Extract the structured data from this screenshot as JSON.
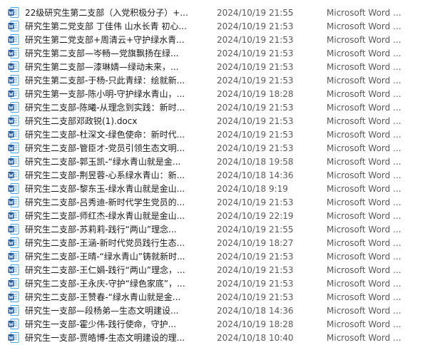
{
  "files": [
    {
      "name": "22级研究生第二支部（入党积极分子）+...",
      "date": "2024/10/19 21:55",
      "type": "Microsoft Word ...",
      "icon": "word-document-icon"
    },
    {
      "name": "研究生第二党支部 丁佳伟 山水长青 初心...",
      "date": "2024/10/19 21:53",
      "type": "Microsoft Word ...",
      "icon": "word-document-icon"
    },
    {
      "name": "研究生第二党支部+周清云+守护绿水青...",
      "date": "2024/10/19 21:53",
      "type": "Microsoft Word ...",
      "icon": "word-document-icon"
    },
    {
      "name": "研究生第二支部—岑畅—党旗飘扬在绿...",
      "date": "2024/10/19 21:53",
      "type": "Microsoft Word ...",
      "icon": "word-document-icon"
    },
    {
      "name": "研究生第二支部—漆琳婧—绿动未来，...",
      "date": "2024/10/19 21:53",
      "type": "Microsoft Word ...",
      "icon": "word-document-icon"
    },
    {
      "name": "研究生第二支部-于杨-只此青绿：绘就新...",
      "date": "2024/10/19 21:53",
      "type": "Microsoft Word ...",
      "icon": "word-document-icon"
    },
    {
      "name": "研究生第一支部-陈小明-守护绿水青山，...",
      "date": "2024/10/19 18:28",
      "type": "Microsoft Word ...",
      "icon": "word-document-icon"
    },
    {
      "name": "研究生二支部-陈曦-从理念到实践：新时...",
      "date": "2024/10/19 21:53",
      "type": "Microsoft Word ...",
      "icon": "word-document-icon"
    },
    {
      "name": "研究生二支部邓政锐(1).docx",
      "date": "2024/10/19 21:53",
      "type": "Microsoft Word ...",
      "icon": "word-document-icon"
    },
    {
      "name": "研究生二支部-杜深文-绿色使命：新时代...",
      "date": "2024/10/19 21:53",
      "type": "Microsoft Word ...",
      "icon": "word-document-icon"
    },
    {
      "name": "研究生二支部-管臣才-党员引领生态文明...",
      "date": "2024/10/19 21:53",
      "type": "Microsoft Word ...",
      "icon": "word-document-icon"
    },
    {
      "name": "研究生二支部-郭玉凯-“绿水青山就是金...",
      "date": "2024/10/18 19:58",
      "type": "Microsoft Word ...",
      "icon": "word-document-icon"
    },
    {
      "name": "研究生二支部-荆昱蓉-心系绿水青山：新...",
      "date": "2024/10/18 14:36",
      "type": "Microsoft Word ...",
      "icon": "word-document-icon"
    },
    {
      "name": "研究生二支部-黎东玉-绿水青山就是金山...",
      "date": "2024/10/18 9:19",
      "type": "Microsoft Word ...",
      "icon": "word-document-icon"
    },
    {
      "name": "研究生二支部-吕秀迪-新时代学生党员的...",
      "date": "2024/10/19 21:53",
      "type": "Microsoft Word ...",
      "icon": "word-document-icon"
    },
    {
      "name": "研究生二支部-师红杰-绿水青山就是金山...",
      "date": "2024/10/19 22:19",
      "type": "Microsoft Word ...",
      "icon": "word-document-icon"
    },
    {
      "name": "研究生二支部-苏莉莉-践行“两山”理念...",
      "date": "2024/10/19 21:55",
      "type": "Microsoft Word ...",
      "icon": "word-document-icon"
    },
    {
      "name": "研究生二支部-王涵-新时代党员践行生态...",
      "date": "2024/10/19 18:27",
      "type": "Microsoft Word ...",
      "icon": "word-document-icon"
    },
    {
      "name": "研究生二支部-王晴-“绿水青山”铸就新时...",
      "date": "2024/10/19 21:53",
      "type": "Microsoft Word ...",
      "icon": "word-document-icon"
    },
    {
      "name": "研究生二支部-王仁娟-践行“两山”理念，...",
      "date": "2024/10/19 21:53",
      "type": "Microsoft Word ...",
      "icon": "word-document-icon"
    },
    {
      "name": "研究生二支部-王永庆-守护“绿色家底”，...",
      "date": "2024/10/19 21:53",
      "type": "Microsoft Word ...",
      "icon": "word-document-icon"
    },
    {
      "name": "研究生二支部-王赞春-“绿水青山就是金...",
      "date": "2024/10/19 21:53",
      "type": "Microsoft Word ...",
      "icon": "word-document-icon"
    },
    {
      "name": "研究生一支部—段杨弟—生态文明建设...",
      "date": "2024/10/18 14:36",
      "type": "Microsoft Word ...",
      "icon": "word-document-icon"
    },
    {
      "name": "研究生一支部-霍少伟-践行使命，守护...",
      "date": "2024/10/19 18:28",
      "type": "Microsoft Word ...",
      "icon": "word-document-icon"
    },
    {
      "name": "研究生一支部-贾皓博-生态文明建设的理...",
      "date": "2024/10/18 10:40",
      "type": "Microsoft Word ...",
      "icon": "word-document-icon"
    }
  ],
  "colors": {
    "word_blue": "#2b5797",
    "word_blue_light": "#41a5ee",
    "text": "#1a1a1a",
    "meta_text": "#5a5a5a"
  }
}
